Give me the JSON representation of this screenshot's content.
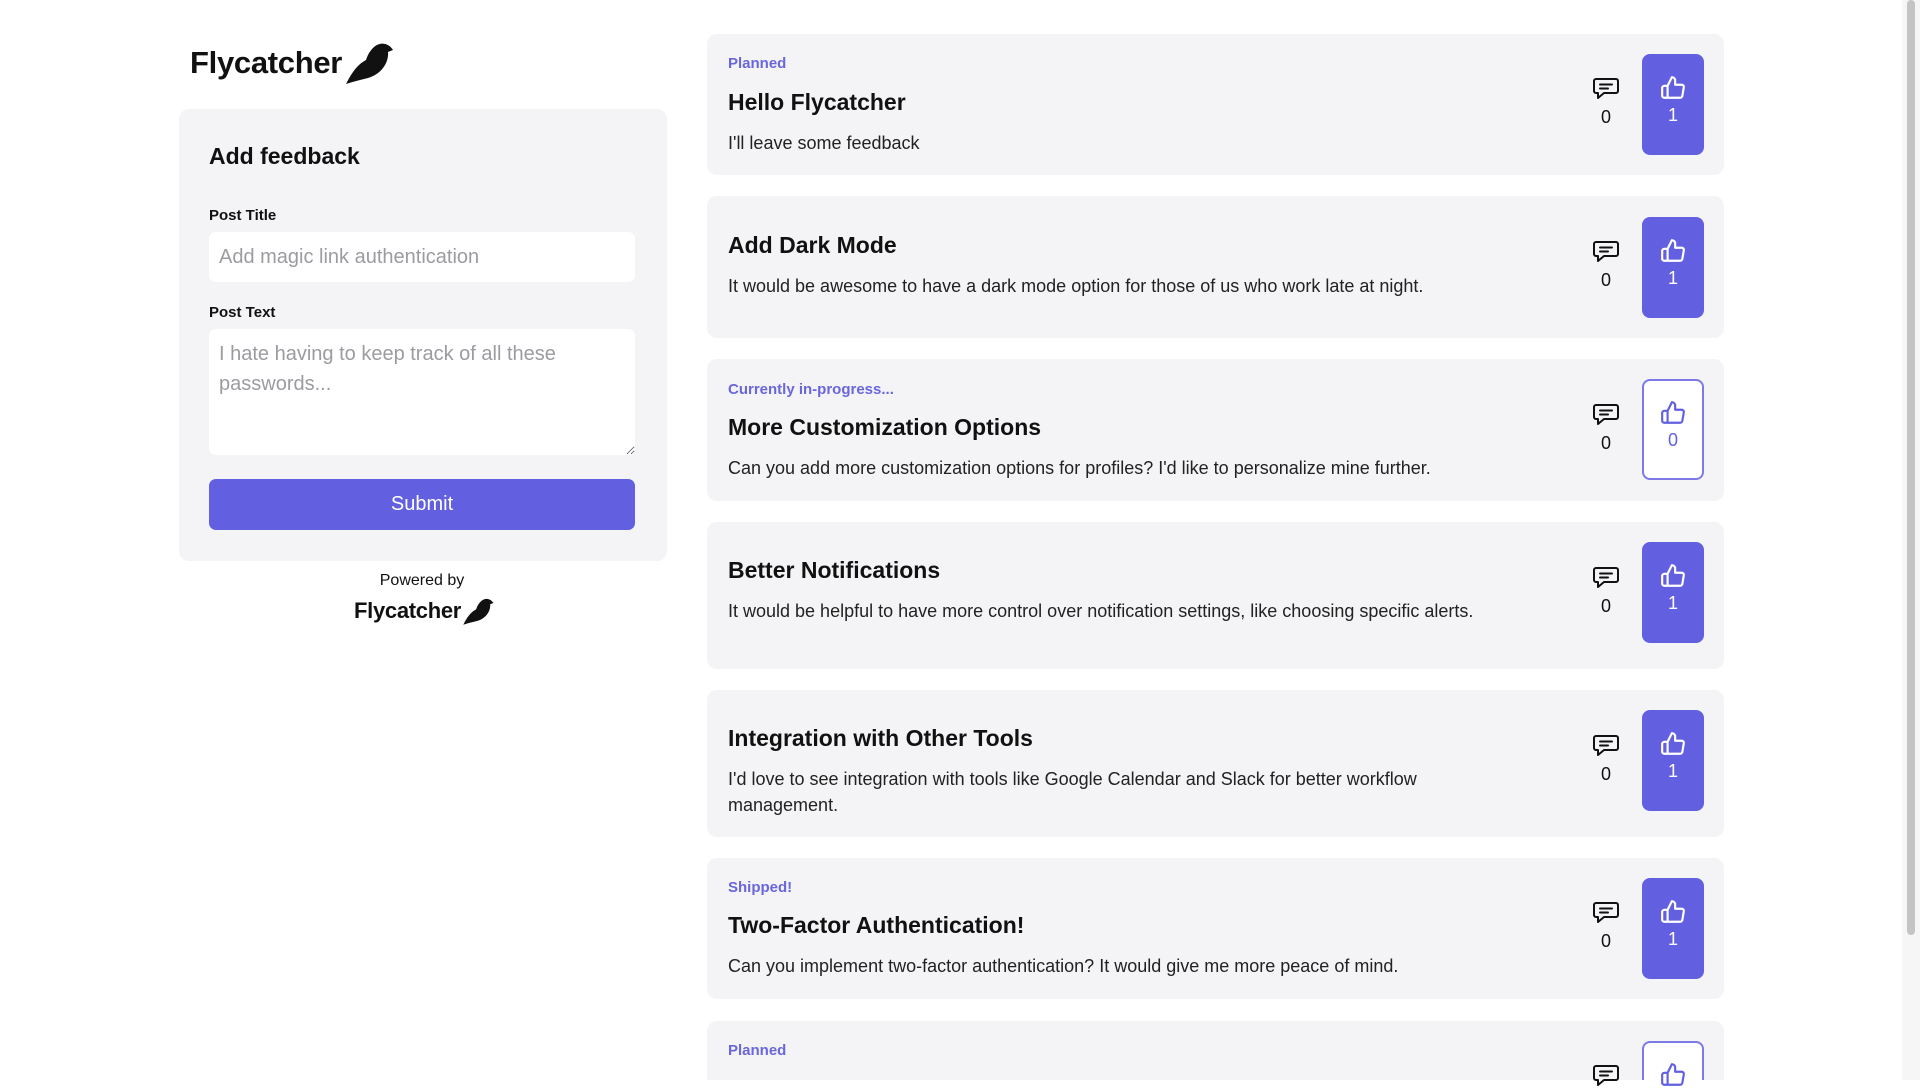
{
  "brand": {
    "name": "Flycatcher",
    "icon": "bird-icon"
  },
  "form": {
    "title": "Add feedback",
    "post_title_label": "Post Title",
    "post_title_placeholder": "Add magic link authentication",
    "post_text_label": "Post Text",
    "post_text_placeholder": "I hate having to keep track of all these passwords...",
    "submit_label": "Submit"
  },
  "footer": {
    "powered_by": "Powered by",
    "brand": "Flycatcher"
  },
  "colors": {
    "accent": "#6260e0",
    "status": "#6a66dc",
    "card": "#f4f4f6"
  },
  "posts": [
    {
      "status": "Planned",
      "title": "Hello Flycatcher",
      "text": "I'll leave some feedback",
      "comments": "0",
      "votes": "1",
      "voted": true
    },
    {
      "status": "",
      "title": "Add Dark Mode",
      "text": "It would be awesome to have a dark mode option for those of us who work late at night.",
      "comments": "0",
      "votes": "1",
      "voted": true
    },
    {
      "status": "Currently in-progress...",
      "title": "More Customization Options",
      "text": "Can you add more customization options for profiles? I'd like to personalize mine further.",
      "comments": "0",
      "votes": "0",
      "voted": false
    },
    {
      "status": "",
      "title": "Better Notifications",
      "text": "It would be helpful to have more control over notification settings, like choosing specific alerts.",
      "comments": "0",
      "votes": "1",
      "voted": true
    },
    {
      "status": "",
      "title": "Integration with Other Tools",
      "text": "I'd love to see integration with tools like Google Calendar and Slack for better workflow management.",
      "comments": "0",
      "votes": "1",
      "voted": true
    },
    {
      "status": "Shipped!",
      "title": "Two-Factor Authentication!",
      "text": "Can you implement two-factor authentication? It would give me more peace of mind.",
      "comments": "0",
      "votes": "1",
      "voted": true
    },
    {
      "status": "Planned",
      "title": "",
      "text": "",
      "comments": "",
      "votes": "",
      "voted": false
    }
  ]
}
